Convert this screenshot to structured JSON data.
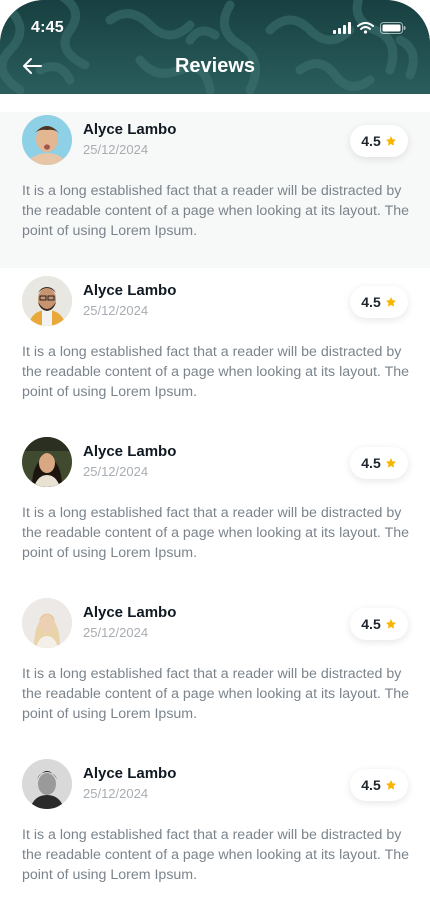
{
  "status_bar": {
    "time": "4:45"
  },
  "header": {
    "title": "Reviews"
  },
  "colors": {
    "header": "#1f4c4d",
    "star": "#f7b500",
    "text_muted": "#7b848c"
  },
  "reviews": [
    {
      "name": "Alyce Lambo",
      "date": "25/12/2024",
      "rating": "4.5",
      "text": "It is a long established fact that a reader will be distracted by the readable content of a page when looking at its layout. The point of using Lorem Ipsum."
    },
    {
      "name": "Alyce Lambo",
      "date": "25/12/2024",
      "rating": "4.5",
      "text": "It is a long established fact that a reader will be distracted by the readable content of a page when looking at its layout. The point of using Lorem Ipsum."
    },
    {
      "name": "Alyce Lambo",
      "date": "25/12/2024",
      "rating": "4.5",
      "text": "It is a long established fact that a reader will be distracted by the readable content of a page when looking at its layout. The point of using Lorem Ipsum."
    },
    {
      "name": "Alyce Lambo",
      "date": "25/12/2024",
      "rating": "4.5",
      "text": "It is a long established fact that a reader will be distracted by the readable content of a page when looking at its layout. The point of using Lorem Ipsum."
    },
    {
      "name": "Alyce Lambo",
      "date": "25/12/2024",
      "rating": "4.5",
      "text": "It is a long established fact that a reader will be distracted by the readable content of a page when looking at its layout. The point of using Lorem Ipsum."
    }
  ]
}
